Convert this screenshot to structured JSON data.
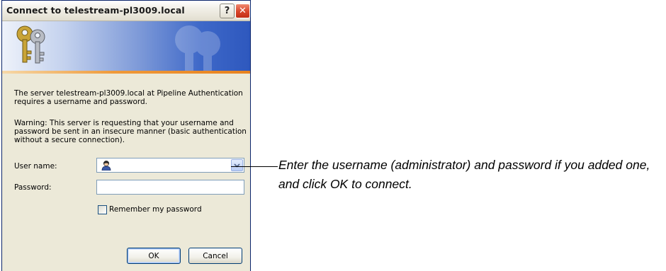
{
  "dialog": {
    "title": "Connect to telestream-pl3009.local",
    "help_button": "?",
    "close_button": "✕",
    "banner_icon": "keys-icon",
    "message": "The server telestream-pl3009.local at Pipeline Authentication requires a username and password.",
    "warning": "Warning: This server is requesting that your username and password be sent in an insecure manner (basic authentication without a secure connection).",
    "username": {
      "label": "User name:",
      "value": "",
      "icon": "user-icon"
    },
    "password": {
      "label": "Password:",
      "value": ""
    },
    "remember": {
      "label": "Remember my password",
      "checked": false
    },
    "ok_label": "OK",
    "cancel_label": "Cancel"
  },
  "callout": {
    "text": "Enter the username (administrator) and password if you added one, and click OK to connect."
  },
  "colors": {
    "close_red": "#d8452a",
    "banner_blue": "#3e68c8",
    "banner_orange": "#ef9a3a",
    "field_border": "#7f9db9"
  }
}
